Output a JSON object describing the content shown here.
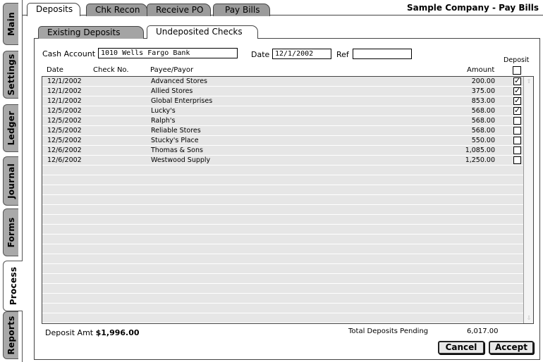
{
  "side_tabs": [
    {
      "label": "Main",
      "active": false
    },
    {
      "label": "Settings",
      "active": false
    },
    {
      "label": "Ledger",
      "active": false
    },
    {
      "label": "Journal",
      "active": false
    },
    {
      "label": "Forms",
      "active": false
    },
    {
      "label": "Process",
      "active": true
    },
    {
      "label": "Reports",
      "active": false
    }
  ],
  "top_tabs": [
    {
      "label": "Deposits",
      "active": true
    },
    {
      "label": "Chk Recon",
      "active": false
    },
    {
      "label": "Receive PO",
      "active": false
    },
    {
      "label": "Pay Bills",
      "active": false
    }
  ],
  "company_title": "Sample Company - Pay Bills",
  "sub_tabs": [
    {
      "label": "Existing Deposits",
      "active": false
    },
    {
      "label": "Undeposited Checks",
      "active": true
    }
  ],
  "form": {
    "cash_account_label": "Cash Account",
    "cash_account_value": "1010 Wells Fargo Bank",
    "date_label": "Date",
    "date_value": "12/1/2002",
    "ref_label": "Ref",
    "ref_value": ""
  },
  "columns": {
    "date": "Date",
    "check_no": "Check No.",
    "payee": "Payee/Payor",
    "amount": "Amount",
    "deposit": "Deposit"
  },
  "rows": [
    {
      "date": "12/1/2002",
      "check_no": "",
      "payee": "Advanced Stores",
      "amount": "200.00",
      "deposit": true
    },
    {
      "date": "12/1/2002",
      "check_no": "",
      "payee": "Allied Stores",
      "amount": "375.00",
      "deposit": true
    },
    {
      "date": "12/1/2002",
      "check_no": "",
      "payee": "Global Enterprises",
      "amount": "853.00",
      "deposit": true
    },
    {
      "date": "12/5/2002",
      "check_no": "",
      "payee": "Lucky's",
      "amount": "568.00",
      "deposit": true
    },
    {
      "date": "12/5/2002",
      "check_no": "",
      "payee": "Ralph's",
      "amount": "568.00",
      "deposit": false
    },
    {
      "date": "12/5/2002",
      "check_no": "",
      "payee": "Reliable Stores",
      "amount": "568.00",
      "deposit": false
    },
    {
      "date": "12/5/2002",
      "check_no": "",
      "payee": "Stucky's Place",
      "amount": "550.00",
      "deposit": false
    },
    {
      "date": "12/6/2002",
      "check_no": "",
      "payee": "Thomas & Sons",
      "amount": "1,085.00",
      "deposit": false
    },
    {
      "date": "12/6/2002",
      "check_no": "",
      "payee": "Westwood Supply",
      "amount": "1,250.00",
      "deposit": false
    }
  ],
  "footer": {
    "deposit_amt_label": "Deposit Amt",
    "deposit_amt_value": "$1,996.00",
    "total_pending_label": "Total Deposits Pending",
    "total_pending_value": "6,017.00",
    "cancel_label": "Cancel",
    "accept_label": "Accept"
  }
}
